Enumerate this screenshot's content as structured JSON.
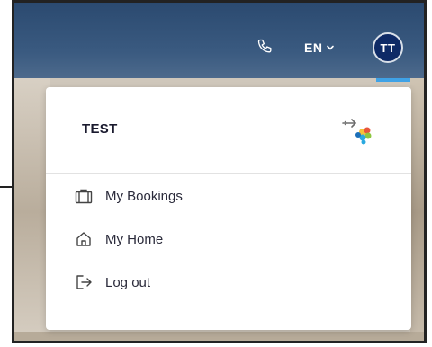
{
  "header": {
    "language": "EN",
    "avatar_initials": "TT"
  },
  "panel": {
    "user_name": "TEST",
    "menu": [
      {
        "label": "My Bookings",
        "icon": "suitcase-icon"
      },
      {
        "label": "My Home",
        "icon": "home-icon"
      },
      {
        "label": "Log out",
        "icon": "logout-icon"
      }
    ]
  },
  "colors": {
    "header": "#2b4a70",
    "avatar": "#0e2a66",
    "active_indicator": "#3fa2e6",
    "panel": "#ffffff",
    "text": "#2a2a3a"
  }
}
